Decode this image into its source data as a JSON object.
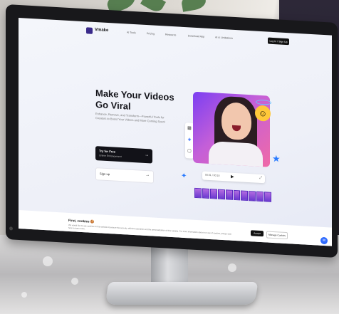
{
  "app": {
    "logo_text": "Vmake"
  },
  "nav": {
    "links": [
      "AI Tools",
      "Pricing",
      "Resource",
      "Download App",
      "AI & Limitations"
    ],
    "login_label": "Log In / Sign Up"
  },
  "hero": {
    "title_line1": "Make Your Videos",
    "title_line2": "Go Viral",
    "subtitle": "Enhance, Remove, and Transform—Powerful Tools for Creators to Boost Your Videos and More Coming Soon!",
    "try_label": "Try for Free",
    "try_sub": "Online Enhancement",
    "signup_label": "Sign up"
  },
  "player": {
    "time": "00:01 / 00:10"
  },
  "cookie": {
    "title": "First, cookies 🍪",
    "text": "We would like to use cookies on this website to ensure the security, efficient operation and the personalization of this website. For more information about our use of cookies, please click here to learn more.",
    "accept_label": "Accept",
    "manage_label": "Manage Cookies"
  },
  "colors": {
    "accent": "#2f6bff",
    "brand": "#3a2a8a",
    "dark": "#121218"
  },
  "icons": [
    "vmake-logo-icon",
    "arrow-right-icon",
    "play-icon",
    "fullscreen-icon",
    "smile-emoji-icon",
    "sparkle-star-icon",
    "chat-icon"
  ]
}
